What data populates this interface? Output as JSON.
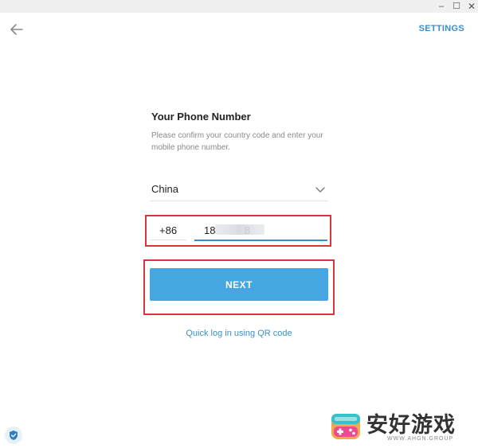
{
  "window": {
    "minimize_glyph": "–",
    "maximize_glyph": "☐",
    "close_glyph": "✕"
  },
  "header": {
    "back_icon": "arrow-left-icon",
    "settings_label": "SETTINGS"
  },
  "form": {
    "title": "Your Phone Number",
    "description": "Please confirm your country code and enter your mobile phone number.",
    "country": {
      "selected": "China",
      "icon": "chevron-down-icon"
    },
    "country_code": "+86",
    "phone_number": "18          8",
    "next_label": "NEXT",
    "qr_link": "Quick log in using QR code"
  },
  "watermark": {
    "text": "安好游戏",
    "subtext": "WWW.AHGN.GROUP"
  },
  "colors": {
    "accent": "#3a8fc4",
    "button": "#45a6e2",
    "highlight_border": "#d9363c",
    "muted_text": "#8a8a8a"
  }
}
